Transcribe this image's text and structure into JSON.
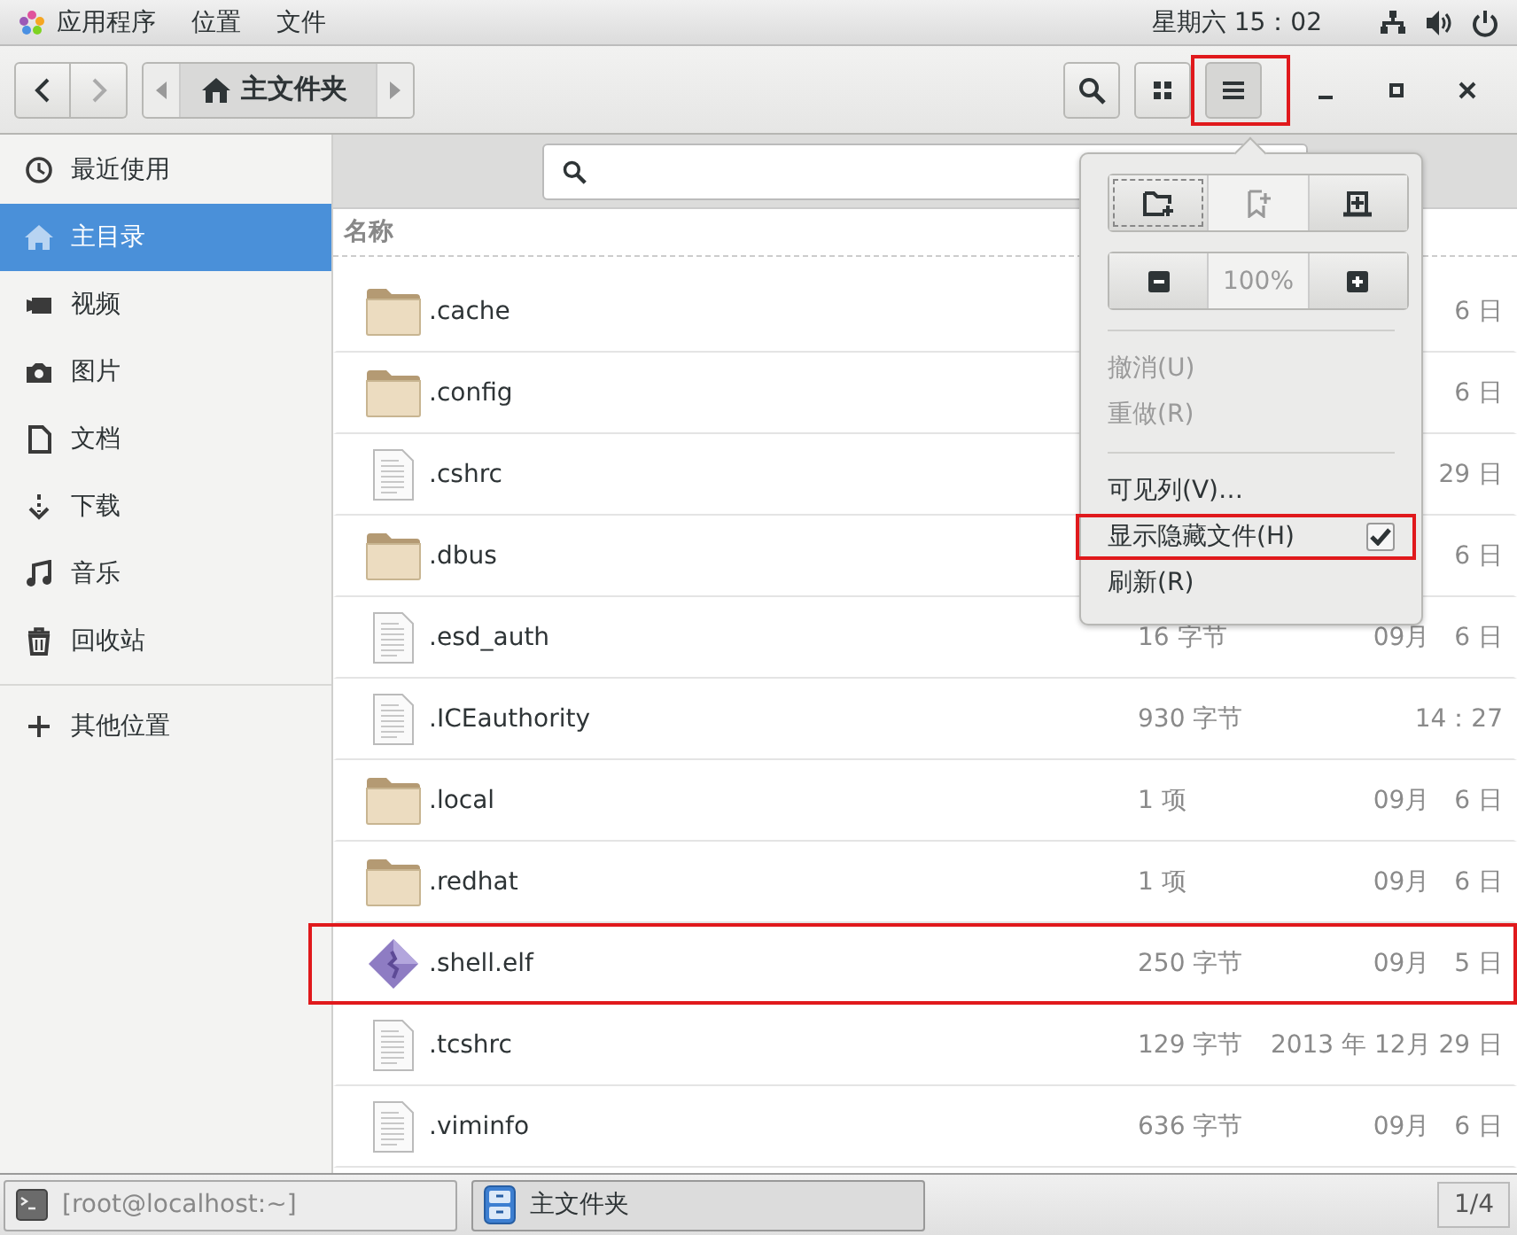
{
  "top_bar": {
    "menus": [
      "应用程序",
      "位置",
      "文件"
    ],
    "clock": "星期六 15：02"
  },
  "header": {
    "path": "主文件夹",
    "menu_button_annotated": true
  },
  "sidebar": {
    "items": [
      {
        "label": "最近使用",
        "selected": false
      },
      {
        "label": "主目录",
        "selected": true
      },
      {
        "label": "视频",
        "selected": false
      },
      {
        "label": "图片",
        "selected": false
      },
      {
        "label": "文档",
        "selected": false
      },
      {
        "label": "下载",
        "selected": false
      },
      {
        "label": "音乐",
        "selected": false
      },
      {
        "label": "回收站",
        "selected": false
      }
    ],
    "other": "其他位置"
  },
  "files": {
    "column": "名称",
    "rows": [
      {
        "name": ".cache",
        "kind": "folder",
        "date": "6 日",
        "annotated": false
      },
      {
        "name": ".config",
        "kind": "folder",
        "date": "6 日",
        "annotated": false
      },
      {
        "name": ".cshrc",
        "kind": "text",
        "date": "29 日",
        "annotated": false
      },
      {
        "name": ".dbus",
        "kind": "folder",
        "date": "6 日",
        "annotated": false
      },
      {
        "name": ".esd_auth",
        "kind": "text",
        "size": "16 字节",
        "date": "09月　6 日",
        "annotated": false
      },
      {
        "name": ".ICEauthority",
        "kind": "text",
        "size": "930 字节",
        "date": "14：27",
        "annotated": false
      },
      {
        "name": ".local",
        "kind": "folder",
        "size": "1 项",
        "date": "09月　6 日",
        "annotated": false
      },
      {
        "name": ".redhat",
        "kind": "folder",
        "size": "1 项",
        "date": "09月　6 日",
        "annotated": false
      },
      {
        "name": ".shell.elf",
        "kind": "executable",
        "size": "250 字节",
        "date": "09月　5 日",
        "annotated": true
      },
      {
        "name": ".tcshrc",
        "kind": "text",
        "size": "129 字节",
        "date": "2013 年 12月 29 日",
        "annotated": false
      },
      {
        "name": ".viminfo",
        "kind": "text",
        "size": "636 字节",
        "date": "09月　6 日",
        "annotated": false
      }
    ]
  },
  "menu": {
    "zoom": "100%",
    "sections": [
      [
        {
          "label": "撤消(U)",
          "disabled": true
        },
        {
          "label": "重做(R)",
          "disabled": true
        }
      ],
      [
        {
          "label": "可见列(V)…",
          "disabled": false
        },
        {
          "label": "显示隐藏文件(H)",
          "disabled": false,
          "kind": "check",
          "checked": true,
          "annotated": true
        },
        {
          "label": "刷新(R)",
          "disabled": false
        }
      ]
    ]
  },
  "taskbar": {
    "windows": [
      {
        "label": "[root@localhost:~]",
        "kind": "terminal",
        "selected": false
      },
      {
        "label": "主文件夹",
        "kind": "files",
        "selected": true
      }
    ],
    "pager": "1/4"
  }
}
